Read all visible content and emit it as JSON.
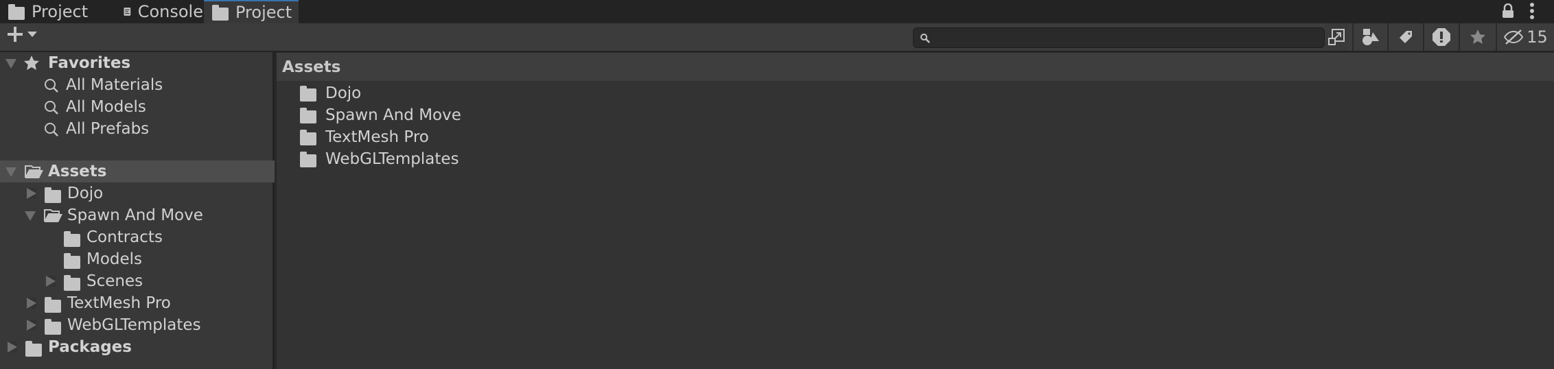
{
  "tabs": [
    {
      "label": "Project",
      "icon": "folder-icon"
    },
    {
      "label": "Console",
      "icon": "console-icon"
    },
    {
      "label": "Project",
      "icon": "folder-icon",
      "active": true
    }
  ],
  "toolbar": {
    "search_placeholder": "",
    "hidden_count": "15"
  },
  "favorites": {
    "label": "Favorites",
    "items": [
      "All Materials",
      "All Models",
      "All Prefabs"
    ]
  },
  "tree": [
    {
      "label": "Assets",
      "level": 0,
      "state": "expanded",
      "bold": true,
      "selected": true,
      "open": true
    },
    {
      "label": "Dojo",
      "level": 1,
      "state": "collapsed"
    },
    {
      "label": "Spawn And Move",
      "level": 1,
      "state": "expanded",
      "open": true
    },
    {
      "label": "Contracts",
      "level": 2,
      "state": "none"
    },
    {
      "label": "Models",
      "level": 2,
      "state": "none"
    },
    {
      "label": "Scenes",
      "level": 2,
      "state": "collapsed"
    },
    {
      "label": "TextMesh Pro",
      "level": 1,
      "state": "collapsed"
    },
    {
      "label": "WebGLTemplates",
      "level": 1,
      "state": "collapsed"
    },
    {
      "label": "Packages",
      "level": 0,
      "state": "collapsed",
      "bold": true
    }
  ],
  "main": {
    "breadcrumb": "Assets",
    "items": [
      "Dojo",
      "Spawn And Move",
      "TextMesh Pro",
      "WebGLTemplates"
    ]
  }
}
